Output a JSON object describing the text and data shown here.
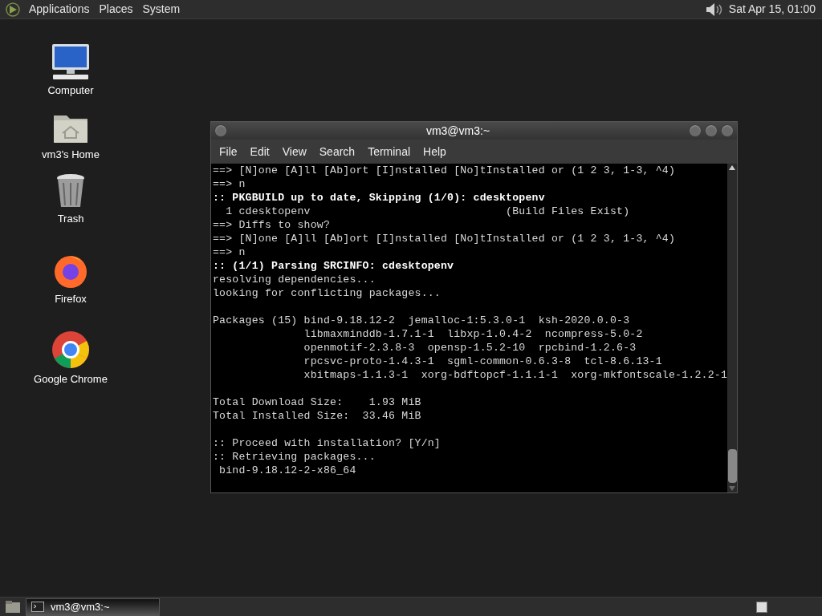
{
  "top_panel": {
    "menus": [
      "Applications",
      "Places",
      "System"
    ],
    "clock": "Sat Apr 15, 01:00"
  },
  "desktop_icons": [
    {
      "kind": "computer",
      "label": "Computer"
    },
    {
      "kind": "home",
      "label": "vm3's Home"
    },
    {
      "kind": "trash",
      "label": "Trash"
    },
    {
      "kind": "firefox",
      "label": "Firefox"
    },
    {
      "kind": "chrome",
      "label": "Google Chrome"
    }
  ],
  "window": {
    "title": "vm3@vm3:~",
    "menu": [
      "File",
      "Edit",
      "View",
      "Search",
      "Terminal",
      "Help"
    ],
    "lines": [
      {
        "kind": "plain",
        "text": "==> [N]one [A]ll [Ab]ort [I]nstalled [No]tInstalled or (1 2 3, 1-3, ^4)"
      },
      {
        "kind": "plain",
        "text": "==> n"
      },
      {
        "kind": "bold",
        "text": ":: PKGBUILD up to date, Skipping (1/0): cdesktopenv"
      },
      {
        "kind": "plain",
        "text": "  1 cdesktopenv                              (Build Files Exist)"
      },
      {
        "kind": "plain",
        "text": "==> Diffs to show?"
      },
      {
        "kind": "plain",
        "text": "==> [N]one [A]ll [Ab]ort [I]nstalled [No]tInstalled or (1 2 3, 1-3, ^4)"
      },
      {
        "kind": "plain",
        "text": "==> n"
      },
      {
        "kind": "bold",
        "text": ":: (1/1) Parsing SRCINFO: cdesktopenv"
      },
      {
        "kind": "plain",
        "text": "resolving dependencies..."
      },
      {
        "kind": "plain",
        "text": "looking for conflicting packages..."
      },
      {
        "kind": "blank"
      },
      {
        "kind": "plain",
        "text": "Packages (15) bind-9.18.12-2  jemalloc-1:5.3.0-1  ksh-2020.0.0-3"
      },
      {
        "kind": "plain",
        "text": "              libmaxminddb-1.7.1-1  libxp-1.0.4-2  ncompress-5.0-2"
      },
      {
        "kind": "plain",
        "text": "              openmotif-2.3.8-3  opensp-1.5.2-10  rpcbind-1.2.6-3"
      },
      {
        "kind": "plain",
        "text": "              rpcsvc-proto-1.4.3-1  sgml-common-0.6.3-8  tcl-8.6.13-1"
      },
      {
        "kind": "plain",
        "text": "              xbitmaps-1.1.3-1  xorg-bdftopcf-1.1.1-1  xorg-mkfontscale-1.2.2-1"
      },
      {
        "kind": "blank"
      },
      {
        "kind": "plain",
        "text": "Total Download Size:    1.93 MiB"
      },
      {
        "kind": "plain",
        "text": "Total Installed Size:  33.46 MiB"
      },
      {
        "kind": "blank"
      },
      {
        "kind": "plain",
        "text": ":: Proceed with installation? [Y/n]"
      },
      {
        "kind": "plain",
        "text": ":: Retrieving packages..."
      },
      {
        "kind": "plain",
        "text": " bind-9.18.12-2-x86_64"
      }
    ]
  },
  "taskbar": {
    "tasks": [
      {
        "label": "vm3@vm3:~",
        "selected": true
      }
    ]
  }
}
